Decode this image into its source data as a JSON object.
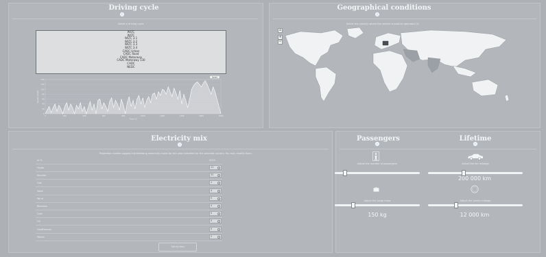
{
  "driving_cycle": {
    "title": "Driving cycle",
    "select_label": "Select a driving cycle",
    "options": [
      "WLTC",
      "WLTC",
      "WLTC 3.1",
      "WLTC 3.2",
      "WLTC 3.3",
      "WLTC 3.4",
      "CADC Urban",
      "CADC Road",
      "CADC Motorway",
      "CADC Motorway 130",
      "CADC",
      "NEDC"
    ],
    "chart": {
      "type": "line",
      "title": "",
      "xlabel": "Time (s)",
      "ylabel": "Speed (km/h)",
      "legend": "Speed",
      "xlim": [
        0,
        1800
      ],
      "ylim": [
        0,
        140
      ],
      "x_ticks": [
        "0",
        "200",
        "400",
        "600",
        "800",
        "1000",
        "1200",
        "1400",
        "1600",
        "1800"
      ],
      "y_ticks": [
        "0",
        "20",
        "40",
        "60",
        "80",
        "100",
        "120",
        "140"
      ],
      "series": [
        {
          "name": "Speed",
          "x": [
            0,
            20,
            40,
            60,
            80,
            100,
            120,
            140,
            160,
            180,
            200,
            220,
            240,
            260,
            280,
            300,
            320,
            340,
            360,
            380,
            400,
            420,
            440,
            460,
            480,
            500,
            520,
            540,
            560,
            580,
            600,
            620,
            640,
            660,
            680,
            700,
            720,
            740,
            760,
            780,
            800,
            820,
            840,
            860,
            880,
            900,
            920,
            940,
            960,
            980,
            1000,
            1020,
            1040,
            1060,
            1080,
            1100,
            1120,
            1140,
            1160,
            1180,
            1200,
            1220,
            1240,
            1260,
            1280,
            1300,
            1320,
            1340,
            1360,
            1380,
            1400,
            1420,
            1440,
            1460,
            1480,
            1500,
            1520,
            1540,
            1560,
            1580,
            1600,
            1620,
            1640,
            1660,
            1680,
            1700,
            1720,
            1740,
            1760,
            1780,
            1800
          ],
          "values": [
            0,
            15,
            30,
            5,
            25,
            40,
            10,
            35,
            20,
            0,
            30,
            45,
            15,
            40,
            25,
            0,
            35,
            20,
            45,
            10,
            30,
            0,
            25,
            50,
            15,
            40,
            0,
            55,
            60,
            20,
            45,
            30,
            10,
            50,
            65,
            25,
            55,
            40,
            15,
            60,
            35,
            0,
            45,
            70,
            30,
            55,
            20,
            60,
            75,
            40,
            65,
            25,
            55,
            70,
            45,
            80,
            85,
            60,
            90,
            75,
            100,
            95,
            80,
            110,
            90,
            70,
            105,
            85,
            60,
            95,
            40,
            80,
            55,
            25,
            60,
            100,
            115,
            125,
            130,
            120,
            110,
            125,
            135,
            120,
            100,
            80,
            110,
            90,
            60,
            30,
            0
          ]
        }
      ]
    }
  },
  "geo": {
    "title": "Geographical conditions",
    "hint": "Select the country where the vehicle should be operated (1)",
    "home_icon": "home-icon",
    "zoom_in": "+",
    "zoom_out": "−"
  },
  "electricity": {
    "title": "Electricity mix",
    "hint": "Projection models suggest the following electricity mixes for the year indicated for the selected country. You may modify them.",
    "header_label": "in %",
    "header_year": "2020",
    "rows": [
      {
        "label": "Hydro",
        "value": "11"
      },
      {
        "label": "Nuclear",
        "value": "32"
      },
      {
        "label": "Gas",
        "value": "1"
      },
      {
        "label": "Solar",
        "value": "4"
      },
      {
        "label": "Wind",
        "value": "0"
      },
      {
        "label": "Biomass",
        "value": "4"
      },
      {
        "label": "Coal",
        "value": "0"
      },
      {
        "label": "Oil",
        "value": "0"
      },
      {
        "label": "Geothermal",
        "value": "0"
      },
      {
        "label": "Waste",
        "value": "2"
      }
    ],
    "button_label": "Set to zero"
  },
  "passengers": {
    "title": "Passengers",
    "number_label": "Adjust the number of passengers",
    "cargo_label": "Adjust the cargo mass",
    "cargo_value": "150 kg",
    "passengers_fraction": 0.12,
    "cargo_fraction": 0.22
  },
  "lifetime": {
    "title": "Lifetime",
    "mileage_label": "Adjust the km mileage",
    "mileage_value": "200 000 km",
    "yearly_label": "Adjust the yearly mileage",
    "yearly_value": "12 000 km",
    "mileage_fraction": 0.38,
    "yearly_fraction": 0.3
  },
  "colors": {
    "background": "#adb1b6",
    "panel": "#b3b7bc",
    "info_dot": "#dfe9f5",
    "line": "#ffffff"
  }
}
